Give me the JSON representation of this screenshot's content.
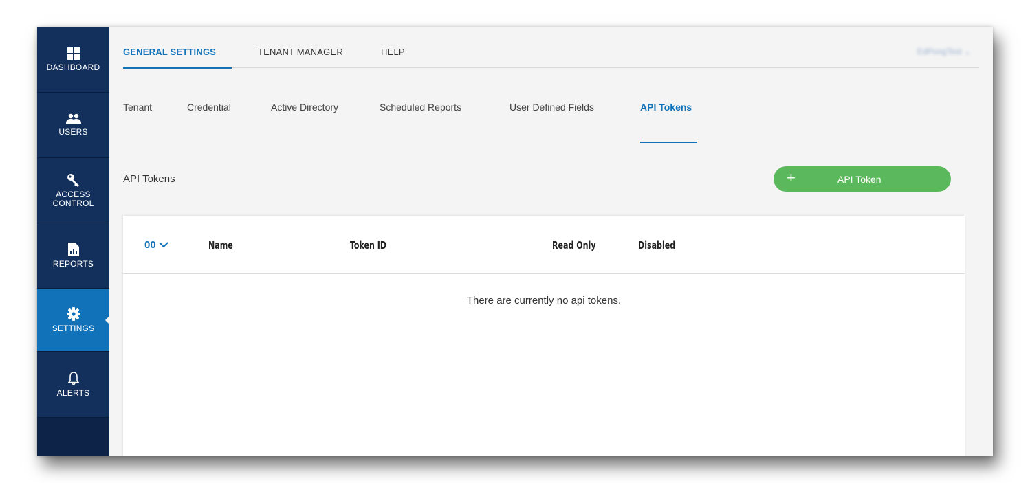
{
  "sidebar": {
    "items": [
      {
        "label": "DASHBOARD",
        "icon": "dashboard-icon"
      },
      {
        "label": "USERS",
        "icon": "users-icon"
      },
      {
        "label": "ACCESS\nCONTROL",
        "icon": "key-icon"
      },
      {
        "label": "REPORTS",
        "icon": "report-icon"
      },
      {
        "label": "SETTINGS",
        "icon": "gear-icon",
        "active": true
      },
      {
        "label": "ALERTS",
        "icon": "bell-icon"
      }
    ]
  },
  "topnav": {
    "tabs": [
      {
        "label": "GENERAL SETTINGS",
        "active": true
      },
      {
        "label": "TENANT MANAGER"
      },
      {
        "label": "HELP"
      }
    ],
    "user": "EdPongTest"
  },
  "subtabs": [
    {
      "label": "Tenant"
    },
    {
      "label": "Credential"
    },
    {
      "label": "Active Directory"
    },
    {
      "label": "Scheduled Reports"
    },
    {
      "label": "User Defined Fields"
    },
    {
      "label": "API Tokens",
      "active": true
    }
  ],
  "section": {
    "title": "API Tokens",
    "add_button_label": "API Token",
    "add_button_icon": "plus-icon"
  },
  "table": {
    "select_label": "00",
    "columns": [
      "Name",
      "Token ID",
      "Read Only",
      "Disabled"
    ],
    "rows": [],
    "empty_message": "There are currently no api tokens."
  },
  "colors": {
    "sidebar_bg": "#13305c",
    "sidebar_active": "#1172b9",
    "accent": "#1172b9",
    "button_green": "#5cb85c"
  }
}
